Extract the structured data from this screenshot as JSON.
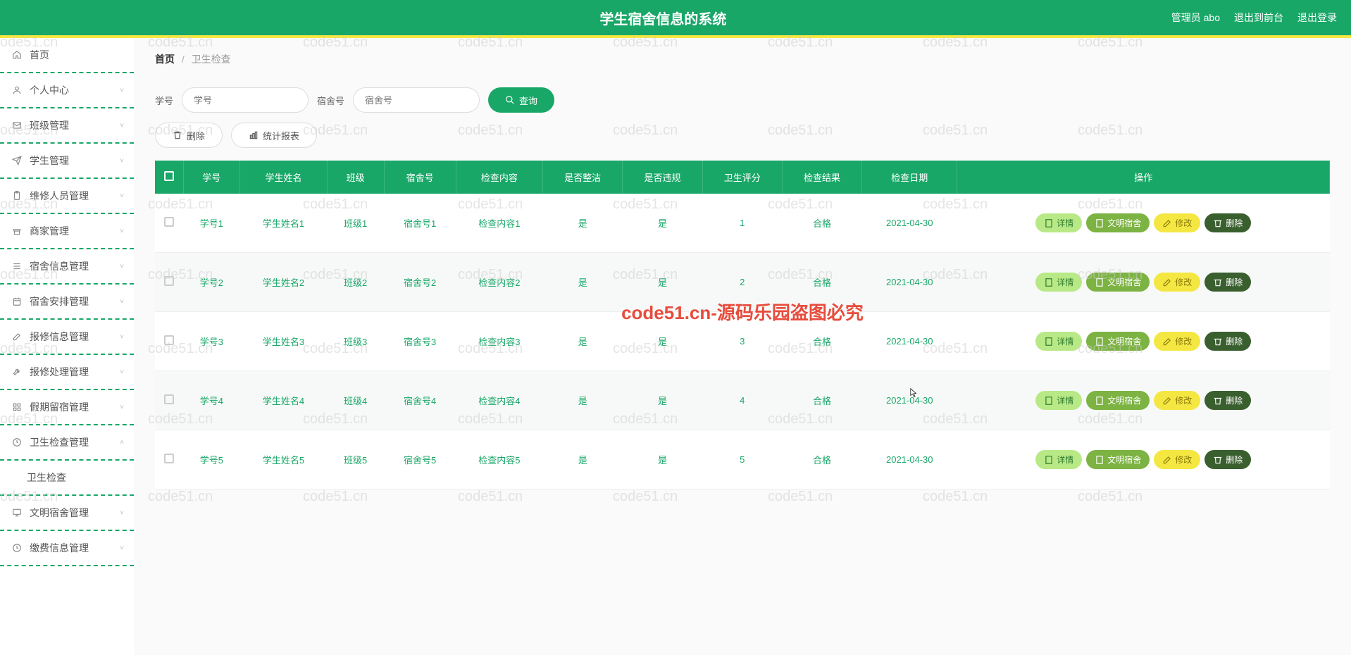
{
  "header": {
    "title": "学生宿舍信息的系统",
    "admin_label": "管理员 abo",
    "to_front": "退出到前台",
    "logout": "退出登录"
  },
  "sidebar": {
    "items": [
      {
        "icon": "home",
        "label": "首页"
      },
      {
        "icon": "user",
        "label": "个人中心",
        "expand": true
      },
      {
        "icon": "mail",
        "label": "班级管理",
        "expand": true
      },
      {
        "icon": "send",
        "label": "学生管理",
        "expand": true
      },
      {
        "icon": "clip",
        "label": "维修人员管理",
        "expand": true
      },
      {
        "icon": "shop",
        "label": "商家管理",
        "expand": true
      },
      {
        "icon": "list",
        "label": "宿舍信息管理",
        "expand": true
      },
      {
        "icon": "cal",
        "label": "宿舍安排管理",
        "expand": true
      },
      {
        "icon": "edit",
        "label": "报修信息管理",
        "expand": true
      },
      {
        "icon": "wrench",
        "label": "报修处理管理",
        "expand": true
      },
      {
        "icon": "grid",
        "label": "假期留宿管理",
        "expand": true
      },
      {
        "icon": "clock",
        "label": "卫生检查管理",
        "expand": true,
        "open": true
      },
      {
        "icon": "",
        "label": "卫生检查",
        "sub": true
      },
      {
        "icon": "screen",
        "label": "文明宿舍管理",
        "expand": true
      },
      {
        "icon": "time",
        "label": "缴费信息管理",
        "expand": true
      }
    ]
  },
  "breadcrumb": {
    "home": "首页",
    "current": "卫生检查"
  },
  "filters": {
    "id_label": "学号",
    "id_ph": "学号",
    "dorm_label": "宿舍号",
    "dorm_ph": "宿舍号",
    "search": "查询"
  },
  "actions": {
    "delete": "删除",
    "report": "统计报表"
  },
  "table": {
    "headers": [
      "",
      "学号",
      "学生姓名",
      "班级",
      "宿舍号",
      "检查内容",
      "是否整洁",
      "是否违规",
      "卫生评分",
      "检查结果",
      "检查日期",
      "操作"
    ],
    "rows": [
      {
        "id": "学号1",
        "name": "学生姓名1",
        "cls": "班级1",
        "dorm": "宿舍号1",
        "content": "检查内容1",
        "clean": "是",
        "violate": "是",
        "score": "1",
        "result": "合格",
        "date": "2021-04-30"
      },
      {
        "id": "学号2",
        "name": "学生姓名2",
        "cls": "班级2",
        "dorm": "宿舍号2",
        "content": "检查内容2",
        "clean": "是",
        "violate": "是",
        "score": "2",
        "result": "合格",
        "date": "2021-04-30"
      },
      {
        "id": "学号3",
        "name": "学生姓名3",
        "cls": "班级3",
        "dorm": "宿舍号3",
        "content": "检查内容3",
        "clean": "是",
        "violate": "是",
        "score": "3",
        "result": "合格",
        "date": "2021-04-30"
      },
      {
        "id": "学号4",
        "name": "学生姓名4",
        "cls": "班级4",
        "dorm": "宿舍号4",
        "content": "检查内容4",
        "clean": "是",
        "violate": "是",
        "score": "4",
        "result": "合格",
        "date": "2021-04-30"
      },
      {
        "id": "学号5",
        "name": "学生姓名5",
        "cls": "班级5",
        "dorm": "宿舍号5",
        "content": "检查内容5",
        "clean": "是",
        "violate": "是",
        "score": "5",
        "result": "合格",
        "date": "2021-04-30"
      }
    ],
    "row_actions": {
      "detail": "详情",
      "civil": "文明宿舍",
      "edit": "修改",
      "delete": "删除"
    }
  },
  "watermark_text": "code51.cn",
  "big_watermark": "code51.cn-源码乐园盗图必究"
}
